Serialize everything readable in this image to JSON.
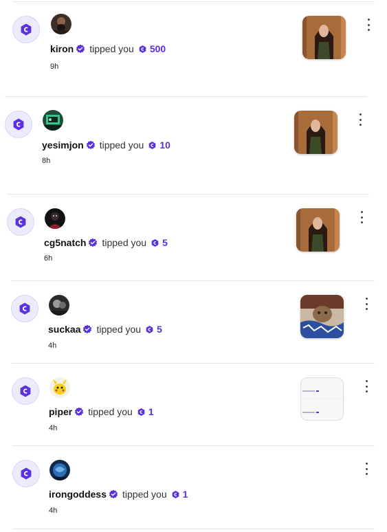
{
  "colors": {
    "accent": "#5b30e0",
    "divider": "#e3e4ea",
    "badge_bg": "#ecebfb"
  },
  "icons": {
    "app_badge": "coin-hex-icon",
    "verified": "verified-badge-icon",
    "coin": "coin-icon",
    "more": "more-vertical-icon"
  },
  "notifications": [
    {
      "user": "kiron",
      "action": "tipped you",
      "amount": "500",
      "time": "9h",
      "avatar": "avatar-dark-beard",
      "thumbnail": "photo-woman-long-hair"
    },
    {
      "user": "yesimjon",
      "action": "tipped you",
      "amount": "10",
      "time": "8h",
      "avatar": "avatar-green-screen",
      "thumbnail": "photo-woman-long-hair"
    },
    {
      "user": "cg5natch",
      "action": "tipped you",
      "amount": "5",
      "time": "6h",
      "avatar": "avatar-dark-red",
      "thumbnail": "photo-woman-long-hair"
    },
    {
      "user": "suckaa",
      "action": "tipped you",
      "amount": "5",
      "time": "4h",
      "avatar": "avatar-bw-portrait",
      "thumbnail": "photo-cat-blanket"
    },
    {
      "user": "piper",
      "action": "tipped you",
      "amount": "1",
      "time": "4h",
      "avatar": "avatar-pikachu",
      "thumbnail": "screenshot-tip-list"
    },
    {
      "user": "irongoddess",
      "action": "tipped you",
      "amount": "1",
      "time": "4h",
      "avatar": "avatar-blue-globe",
      "thumbnail": ""
    }
  ]
}
